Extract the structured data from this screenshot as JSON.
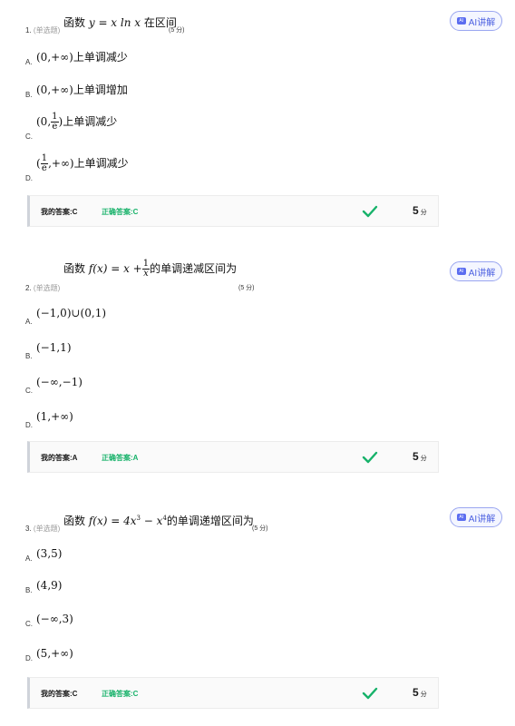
{
  "ai_button_label": "AI讲解",
  "ai_badge": "AI",
  "answer_labels": {
    "mine": "我的答案:",
    "correct": "正确答案:",
    "points_unit": "分"
  },
  "questions": [
    {
      "number": "1.",
      "type": "(单选题)",
      "stem_pre": "函数",
      "stem_math": "y = x ln x",
      "stem_post": "在区间",
      "score_note": "(5 分)",
      "options": [
        {
          "letter": "A.",
          "math": "(0,+∞)",
          "text": "上单调减少"
        },
        {
          "letter": "B.",
          "math": "(0,+∞)",
          "text": "上单调增加"
        },
        {
          "letter": "C.",
          "math_pre": "(0,",
          "frac_num": "1",
          "frac_den": "e",
          "math_post": ")",
          "text": "上单调减少"
        },
        {
          "letter": "D.",
          "math_pre": "(",
          "frac_num": "1",
          "frac_den": "e",
          "math_post": ",+∞)",
          "text": "上单调减少"
        }
      ],
      "my_answer": "C",
      "correct_answer": "C",
      "points": "5"
    },
    {
      "number": "2.",
      "type": "(单选题)",
      "stem_pre": "函数",
      "stem_math_pre": "f(x) = x +",
      "stem_frac_num": "1",
      "stem_frac_den": "x",
      "stem_post": "的单调递减区间为",
      "score_note": "(5 分)",
      "options": [
        {
          "letter": "A.",
          "math": "(−1,0)∪(0,1)"
        },
        {
          "letter": "B.",
          "math": "(−1,1)"
        },
        {
          "letter": "C.",
          "math": "(−∞,−1)"
        },
        {
          "letter": "D.",
          "math": "(1,+∞)"
        }
      ],
      "my_answer": "A",
      "correct_answer": "A",
      "points": "5"
    },
    {
      "number": "3.",
      "type": "(单选题)",
      "stem_pre": "函数",
      "stem_math_a": "f(x) = 4x",
      "stem_sup_a": "3",
      "stem_math_b": " − x",
      "stem_sup_b": "4",
      "stem_post": "的单调递增区间为",
      "score_note": "(5 分)",
      "options": [
        {
          "letter": "A.",
          "math": "(3,5)"
        },
        {
          "letter": "B.",
          "math": "(4,9)"
        },
        {
          "letter": "C.",
          "math": "(−∞,3)"
        },
        {
          "letter": "D.",
          "math": "(5,+∞)"
        }
      ],
      "my_answer": "C",
      "correct_answer": "C",
      "points": "5"
    }
  ]
}
